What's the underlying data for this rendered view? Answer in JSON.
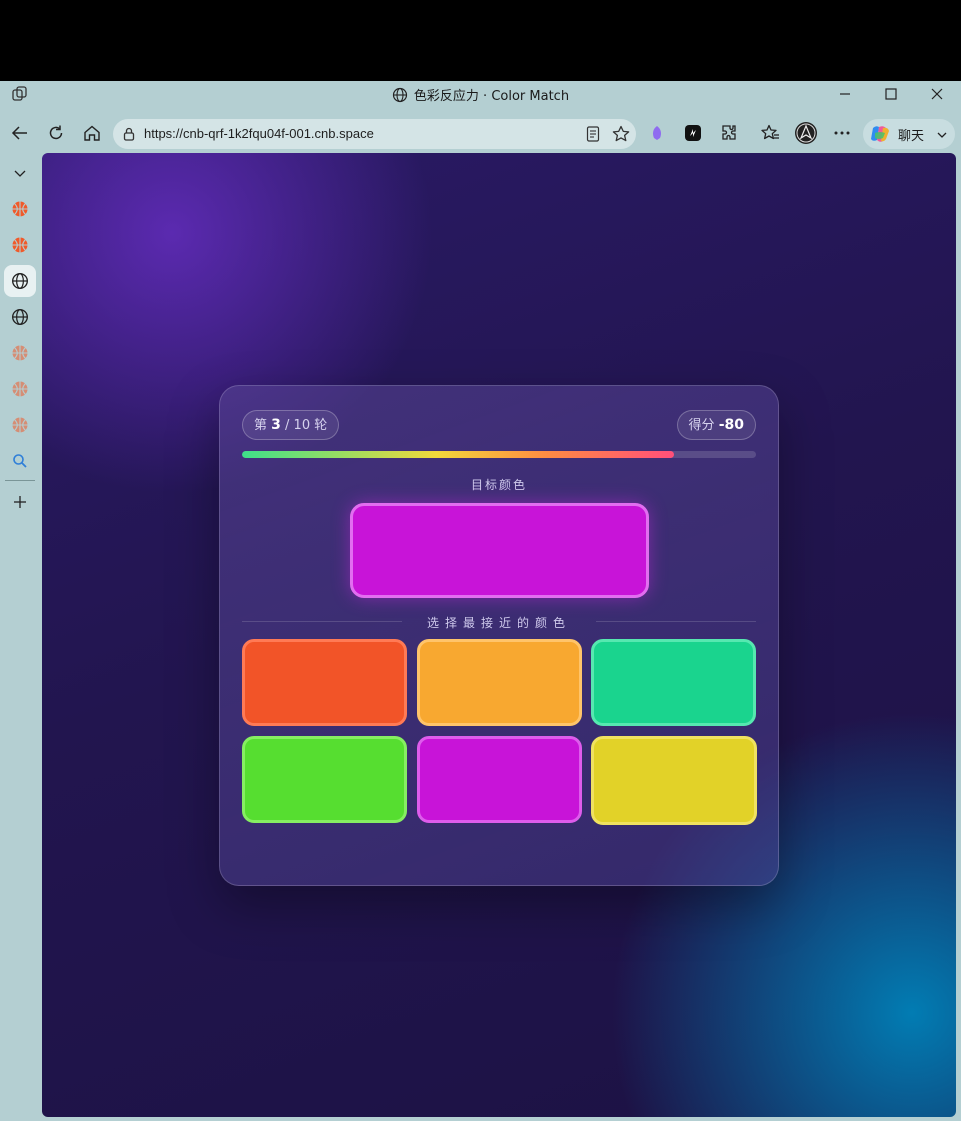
{
  "browser": {
    "tab_title": "色彩反应力 · Color Match",
    "url": "https://cnb-qrf-1k2fqu04f-001.cnb.space",
    "copilot_label": "聊天"
  },
  "game": {
    "round_prefix": "第",
    "round_current": "3",
    "round_suffix": "/ 10 轮",
    "score_label": "得分",
    "score_value": "-80",
    "progress": 0.84,
    "target_label": "目标颜色",
    "target_color": "#c814d8",
    "choose_label": "选择最接近的颜色",
    "options": [
      {
        "color": "#f25428",
        "border": "#ff7a55"
      },
      {
        "color": "#f8a830",
        "border": "#ffc46a"
      },
      {
        "color": "#1ad48e",
        "border": "#56e8b0"
      },
      {
        "color": "#56de30",
        "border": "#86ee62"
      },
      {
        "color": "#c814d8",
        "border": "#de5cec"
      },
      {
        "color": "#e2d228",
        "border": "#f0e260"
      }
    ]
  },
  "colors": {
    "accent_purple": "#c814d8",
    "background_dark": "#22154f"
  }
}
